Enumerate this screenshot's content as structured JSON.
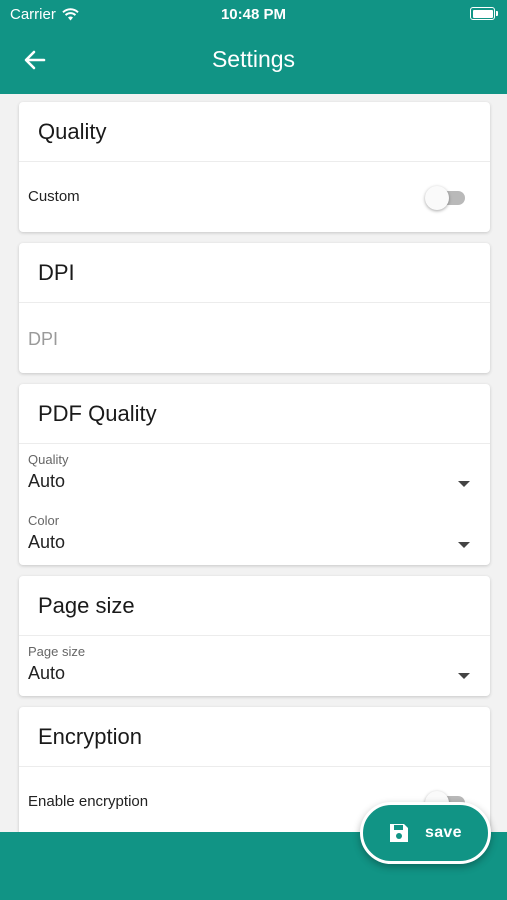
{
  "status_bar": {
    "carrier": "Carrier",
    "time": "10:48 PM"
  },
  "header": {
    "title": "Settings",
    "back_icon": "arrow-left-icon"
  },
  "quality": {
    "title": "Quality",
    "custom_label": "Custom",
    "custom_enabled": false
  },
  "dpi": {
    "title": "DPI",
    "placeholder": "DPI"
  },
  "pdf_quality": {
    "title": "PDF Quality",
    "quality_label": "Quality",
    "quality_value": "Auto",
    "color_label": "Color",
    "color_value": "Auto"
  },
  "page_size": {
    "title": "Page size",
    "label": "Page size",
    "value": "Auto"
  },
  "encryption": {
    "title": "Encryption",
    "enable_label": "Enable encryption",
    "enabled": false
  },
  "fab": {
    "label": "save",
    "icon": "floppy-disk-icon"
  },
  "colors": {
    "primary": "#119485",
    "surface": "#ffffff",
    "background": "#f2f2f2"
  }
}
